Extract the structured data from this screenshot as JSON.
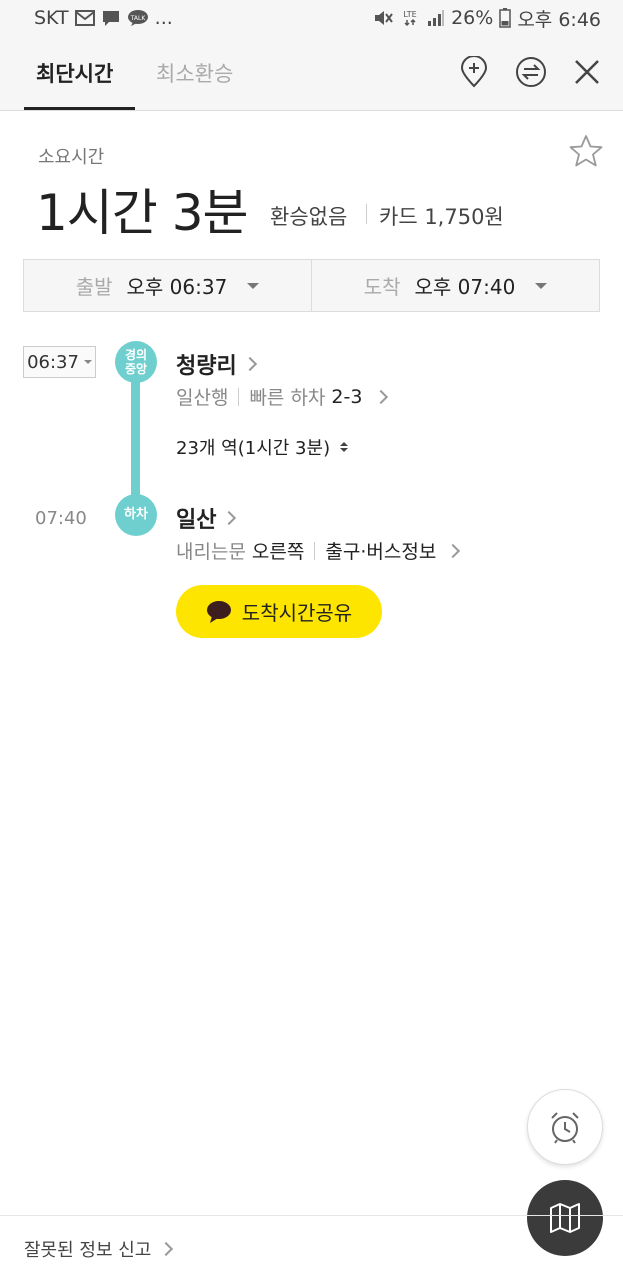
{
  "status_bar": {
    "carrier": "SKT",
    "network": "LTE",
    "battery": "26%",
    "time": "오후 6:46",
    "icons": [
      "email-icon",
      "chat-icon",
      "talk-icon",
      "mute-icon",
      "lte-icon",
      "signal-icon",
      "battery-icon"
    ]
  },
  "tabs": {
    "fastest": "최단시간",
    "fewest_transfers": "최소환승"
  },
  "header_icons": [
    "add-place-icon",
    "swap-icon",
    "close-icon"
  ],
  "summary": {
    "label": "소요시간",
    "duration": "1시간 3분",
    "transfers": "환승없음",
    "fare": "카드 1,750원"
  },
  "time_select": {
    "depart_label": "출발",
    "depart_value": "오후 06:37",
    "arrive_label": "도착",
    "arrive_value": "오후 07:40"
  },
  "route": {
    "depart_time": "06:37",
    "line_badge": "경의\n중앙",
    "start_station": "청량리",
    "direction": "일산행",
    "fast_exit_label": "빠른 하차",
    "fast_exit_value": "2-3",
    "stops_summary": "23개 역(1시간 3분)",
    "arrive_time": "07:40",
    "alight_badge": "하차",
    "end_station": "일산",
    "door_label": "내리는문",
    "door_value": "오른쪽",
    "exit_info": "출구·버스정보"
  },
  "share_button": "도착시간공유",
  "report_link": "잘못된 정보 신고",
  "colors": {
    "line_accent": "#6ecfce",
    "share_yellow": "#fee500",
    "map_fab": "#3b3b3b"
  }
}
